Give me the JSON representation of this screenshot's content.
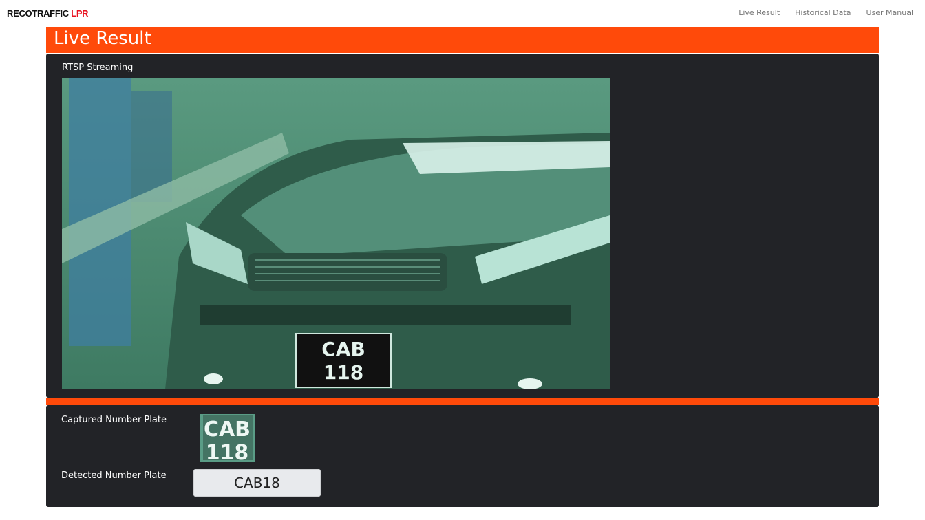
{
  "app": {
    "brand_main": "RECOTRAFFIC ",
    "brand_accent": "LPR"
  },
  "nav": {
    "items": [
      {
        "label": "Live Result"
      },
      {
        "label": "Historical Data"
      },
      {
        "label": "User Manual"
      }
    ]
  },
  "page": {
    "title": "Live Result"
  },
  "stream": {
    "label": "RTSP Streaming",
    "plate_line1": "CAB",
    "plate_line2": "118"
  },
  "result": {
    "captured_label": "Captured Number Plate",
    "captured_line1": "CAB",
    "captured_line2": "118",
    "detected_label": "Detected Number Plate",
    "detected_value": "CAB18"
  },
  "colors": {
    "accent": "#ff4a0a",
    "panel": "#222327",
    "brand_accent": "#e8101e"
  }
}
